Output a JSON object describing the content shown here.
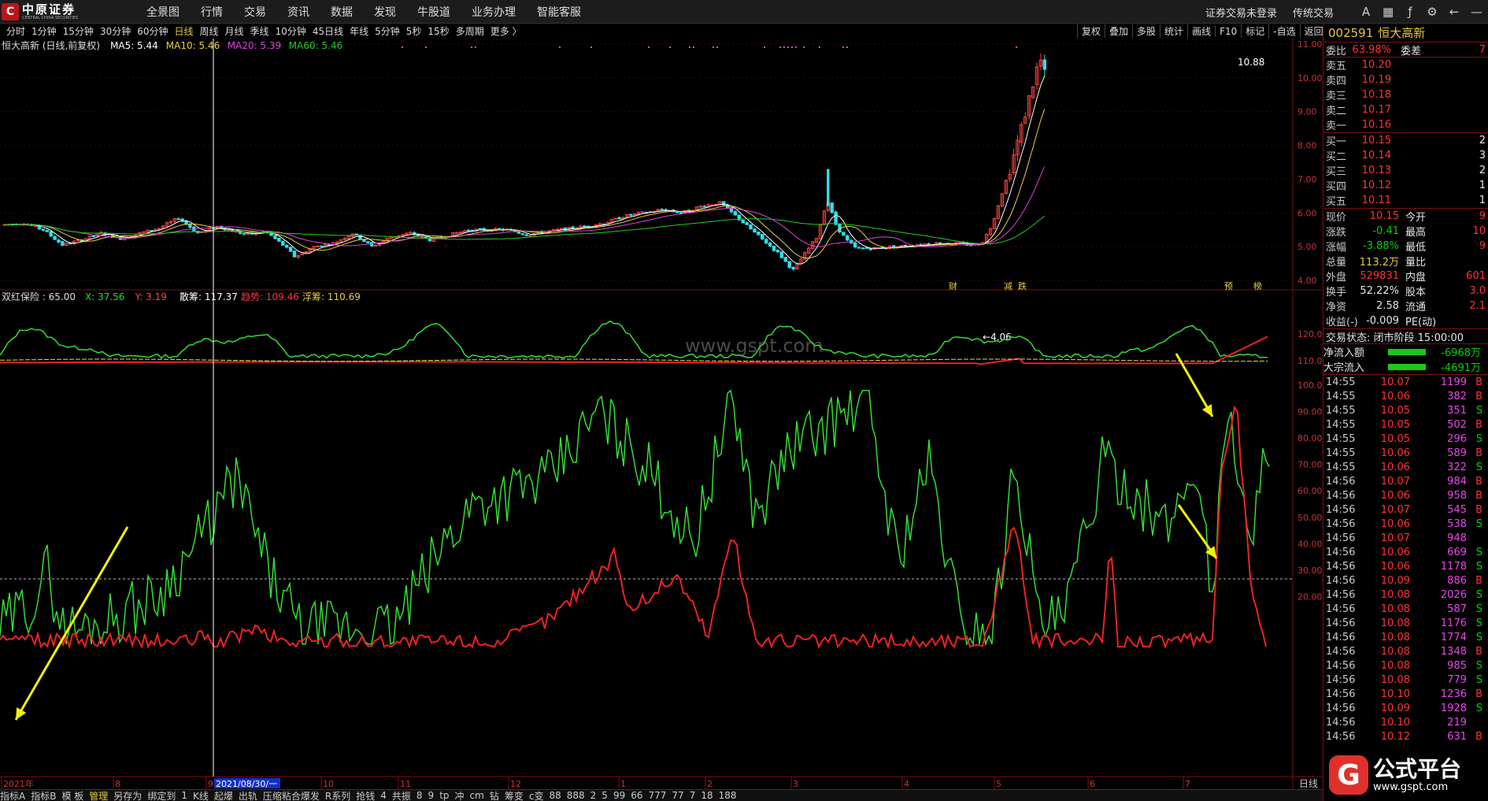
{
  "app": {
    "brand_cn": "中原证券",
    "brand_en": "CENTRAL CHINA SECURITIES"
  },
  "menu": [
    "全景图",
    "行情",
    "交易",
    "资讯",
    "数据",
    "发现",
    "牛股道",
    "业务办理",
    "智能客服"
  ],
  "topright": {
    "login": "证券交易未登录",
    "classic": "传统交易",
    "icons": [
      "font-size-icon",
      "grid-icon",
      "formula-icon",
      "gear-icon",
      "back-icon",
      "minimize-icon"
    ]
  },
  "periods": [
    "分时",
    "1分钟",
    "15分钟",
    "30分钟",
    "60分钟",
    "日线",
    "周线",
    "月线",
    "季线",
    "10分钟",
    "45日线",
    "年线",
    "5分钟",
    "5秒",
    "15秒",
    "多周期",
    "更多 〉"
  ],
  "active_period": "日线",
  "tools": [
    "复权",
    "叠加",
    "多股",
    "统计",
    "画线",
    "F10",
    "标记",
    "-自选",
    "返回"
  ],
  "main_chart": {
    "title": "恒大高新 (日线,前复权)",
    "ma": [
      {
        "label": "MA5: 5.44",
        "color": "#ffffff"
      },
      {
        "label": "MA10: 5.46",
        "color": "#e8d040"
      },
      {
        "label": "MA20: 5.39",
        "color": "#dd44dd"
      },
      {
        "label": "MA60: 5.46",
        "color": "#22cc22"
      }
    ],
    "y_ticks": [
      "11.00",
      "10.00",
      "9.00",
      "8.00",
      "7.00",
      "6.00",
      "5.00",
      "4.00"
    ],
    "high_label": "10.88",
    "low_label": "4.06",
    "markers": [
      "财",
      "减",
      "跌",
      "预",
      "榜"
    ]
  },
  "indicator1": {
    "title": "双红保险 : 65.00",
    "vals": [
      {
        "label": "X: 37.56",
        "color": "#22dd22"
      },
      {
        "label": "Y: 3.19",
        "color": "#ff4444"
      },
      {
        "label": "散筹: 117.37",
        "color": "#ffffff"
      },
      {
        "label": "趋势: 109.46",
        "color": "#ff3333"
      },
      {
        "label": "浮筹: 110.69",
        "color": "#e8d040"
      }
    ],
    "y_ticks": [
      "120.0",
      "110.0"
    ],
    "watermark": "www.gspt.com"
  },
  "indicator2": {
    "y_ticks": [
      "100.0",
      "90.00",
      "80.00",
      "70.00",
      "60.00",
      "50.00",
      "40.00",
      "30.00",
      "20.00"
    ]
  },
  "x_axis": {
    "labels": [
      "2021年",
      "8",
      "9",
      "10",
      "11",
      "12",
      "1",
      "2",
      "3",
      "4",
      "5",
      "6",
      "7"
    ],
    "cursor_date": "2021/08/30/一"
  },
  "stock": {
    "code": "002591",
    "name": "恒大高新"
  },
  "order_ratio": {
    "label": "委比",
    "value": "63.98%",
    "label2": "委差",
    "value2": "7"
  },
  "asks": [
    {
      "l": "卖五",
      "p": "10.20",
      "v": ""
    },
    {
      "l": "卖四",
      "p": "10.19",
      "v": ""
    },
    {
      "l": "卖三",
      "p": "10.18",
      "v": ""
    },
    {
      "l": "卖二",
      "p": "10.17",
      "v": ""
    },
    {
      "l": "卖一",
      "p": "10.16",
      "v": ""
    }
  ],
  "bids": [
    {
      "l": "买一",
      "p": "10.15",
      "v": "2"
    },
    {
      "l": "买二",
      "p": "10.14",
      "v": "3"
    },
    {
      "l": "买三",
      "p": "10.13",
      "v": "2"
    },
    {
      "l": "买四",
      "p": "10.12",
      "v": "1"
    },
    {
      "l": "买五",
      "p": "10.11",
      "v": "1"
    }
  ],
  "quote": [
    {
      "l": "现价",
      "v": "10.15",
      "c": "red",
      "l2": "今开",
      "v2": "9"
    },
    {
      "l": "涨跌",
      "v": "-0.41",
      "c": "grn",
      "l2": "最高",
      "v2": "10"
    },
    {
      "l": "涨幅",
      "v": "-3.88%",
      "c": "grn",
      "l2": "最低",
      "v2": "9"
    },
    {
      "l": "总量",
      "v": "113.2万",
      "c": "yel",
      "l2": "量比",
      "v2": ""
    },
    {
      "l": "外盘",
      "v": "529831",
      "c": "red",
      "l2": "内盘",
      "v2": "601"
    },
    {
      "l": "换手",
      "v": "52.22%",
      "c": "wht",
      "l2": "股本",
      "v2": "3.0"
    },
    {
      "l": "净资",
      "v": "2.58",
      "c": "wht",
      "l2": "流通",
      "v2": "2.1"
    },
    {
      "l": "收益(-)",
      "v": "-0.009",
      "c": "wht",
      "l2": "PE(动)",
      "v2": ""
    }
  ],
  "status": "交易状态: 闭市阶段 15:00:00",
  "flows": [
    {
      "l": "净流入额",
      "v": "-6968万"
    },
    {
      "l": "大宗流入",
      "v": "-4691万"
    }
  ],
  "trades": [
    {
      "t": "14:55",
      "p": "10.07",
      "v": "1199",
      "s": "B"
    },
    {
      "t": "14:55",
      "p": "10.06",
      "v": "382",
      "s": "B"
    },
    {
      "t": "14:55",
      "p": "10.05",
      "v": "351",
      "s": "S"
    },
    {
      "t": "14:55",
      "p": "10.05",
      "v": "502",
      "s": "B"
    },
    {
      "t": "14:55",
      "p": "10.05",
      "v": "296",
      "s": "S"
    },
    {
      "t": "14:55",
      "p": "10.06",
      "v": "589",
      "s": "B"
    },
    {
      "t": "14:55",
      "p": "10.06",
      "v": "322",
      "s": "S"
    },
    {
      "t": "14:56",
      "p": "10.07",
      "v": "984",
      "s": "B"
    },
    {
      "t": "14:56",
      "p": "10.06",
      "v": "958",
      "s": "B"
    },
    {
      "t": "14:56",
      "p": "10.07",
      "v": "545",
      "s": "B"
    },
    {
      "t": "14:56",
      "p": "10.06",
      "v": "538",
      "s": "S"
    },
    {
      "t": "14:56",
      "p": "10.07",
      "v": "948",
      "s": ""
    },
    {
      "t": "14:56",
      "p": "10.06",
      "v": "669",
      "s": "S"
    },
    {
      "t": "14:56",
      "p": "10.06",
      "v": "1178",
      "s": "S"
    },
    {
      "t": "14:56",
      "p": "10.09",
      "v": "886",
      "s": "B"
    },
    {
      "t": "14:56",
      "p": "10.08",
      "v": "2026",
      "s": "S"
    },
    {
      "t": "14:56",
      "p": "10.08",
      "v": "587",
      "s": "S"
    },
    {
      "t": "14:56",
      "p": "10.08",
      "v": "1176",
      "s": "S"
    },
    {
      "t": "14:56",
      "p": "10.08",
      "v": "1774",
      "s": "S"
    },
    {
      "t": "14:56",
      "p": "10.08",
      "v": "1348",
      "s": "B"
    },
    {
      "t": "14:56",
      "p": "10.08",
      "v": "985",
      "s": "S"
    },
    {
      "t": "14:56",
      "p": "10.08",
      "v": "779",
      "s": "S"
    },
    {
      "t": "14:56",
      "p": "10.10",
      "v": "1236",
      "s": "B"
    },
    {
      "t": "14:56",
      "p": "10.09",
      "v": "1928",
      "s": "S"
    },
    {
      "t": "14:56",
      "p": "10.10",
      "v": "219",
      "s": ""
    },
    {
      "t": "14:56",
      "p": "10.12",
      "v": "631",
      "s": "B"
    }
  ],
  "bottom": [
    "指标A",
    "指标B",
    "模 板",
    "管理",
    "另存为",
    "绑定到",
    "1",
    "K线",
    "起爆",
    "出轨",
    "压缩粘合爆发",
    "R系列",
    "抢钱",
    "4",
    "共振",
    "8",
    "9",
    "tp",
    "冲",
    "cm",
    "钻",
    "筹变",
    "c变",
    "88",
    "888",
    "2",
    "5",
    "99",
    "66",
    "777",
    "77",
    "7",
    "18",
    "188"
  ],
  "bottom_active": "管理",
  "day_label": "日线",
  "footer_brand": {
    "logo": "G",
    "name": "公式平台",
    "url": "www.gspt.com"
  }
}
